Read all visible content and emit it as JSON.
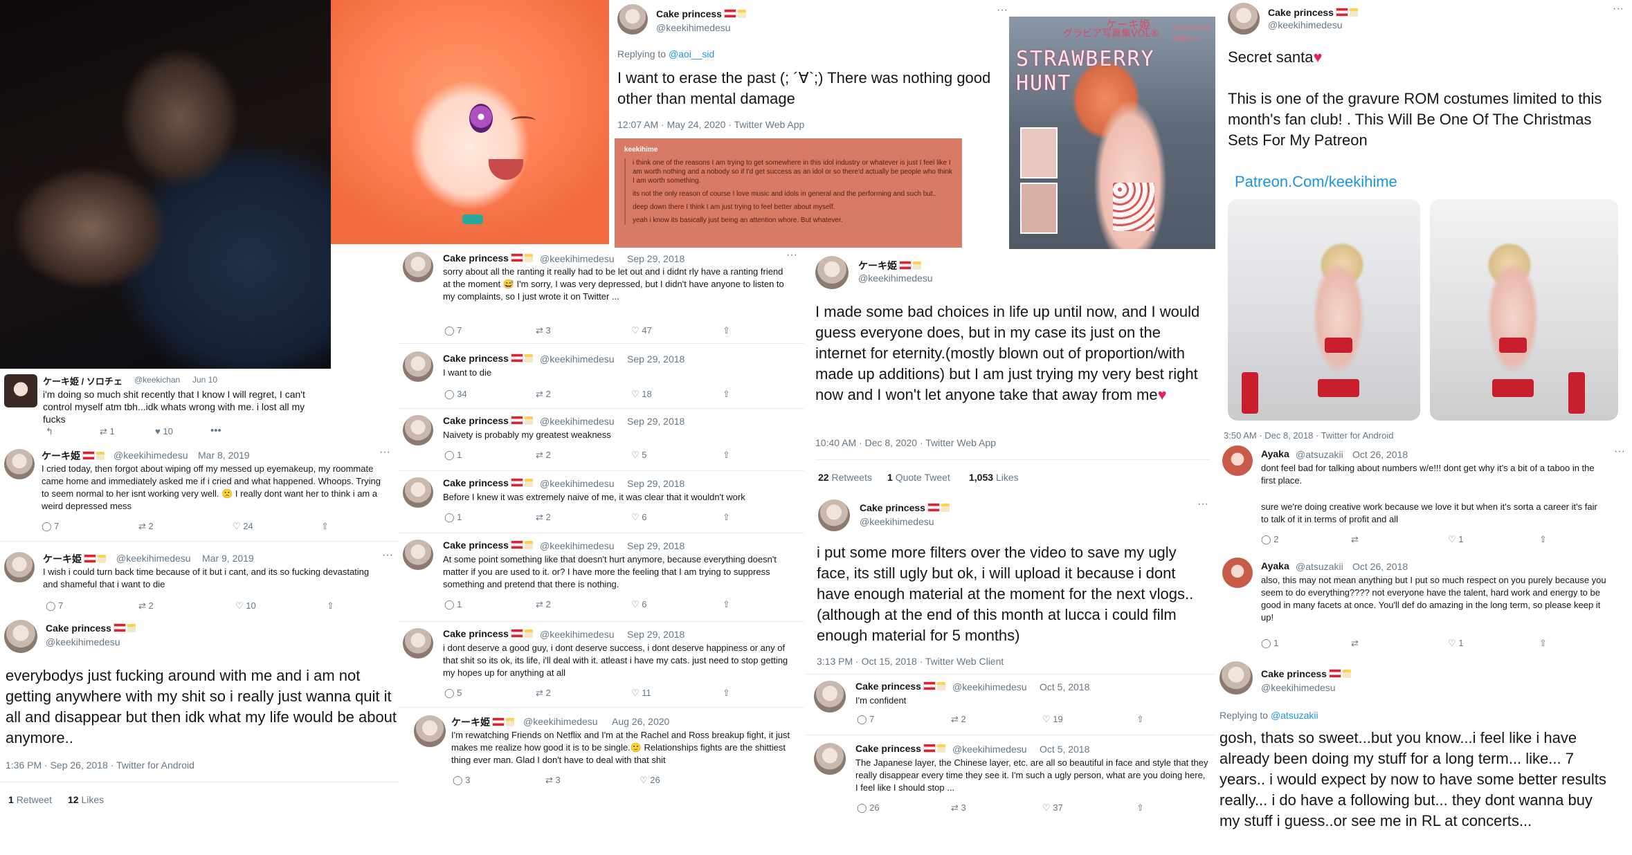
{
  "tweets": {
    "t_keechan": {
      "name": "ケーキ姫 / ソロチェ",
      "handle": "@keekichan",
      "date": "Jun 10",
      "text": "i'm doing so much shit recently that I know I will regret, I can't control myself atm tbh...idk whats wrong with me. i lost all my fucks",
      "retweets": "1",
      "likes": "10"
    },
    "t_mar8": {
      "name": "ケーキ姫",
      "handle": "@keekihimedesu",
      "date": "Mar 8, 2019",
      "text": "I cried today, then forgot about wiping off my messed up eyemakeup, my roommate came home and immediately asked me if i cried and what happened. Whoops. Trying to seem normal to her isnt working very well. 🙁 I really dont want her to think i am a weird depressed mess",
      "replies": "7",
      "retweets": "2",
      "likes": "24"
    },
    "t_mar9": {
      "name": "ケーキ姫",
      "handle": "@keekihimedesu",
      "date": "Mar 9, 2019",
      "text": "I wish i could turn back time because of it but i cant, and its so fucking devastating and shameful that i want to die",
      "replies": "7",
      "retweets": "2",
      "likes": "10"
    },
    "t_sep26": {
      "name": "Cake princess",
      "handle": "@keekihimedesu",
      "text": "everybodys just fucking around with me and i am not getting anywhere with my shit so i really just wanna quit it all and disappear but then idk what my life would be about anymore..",
      "time": "1:36 PM · Sep 26, 2018 · Twitter for Android",
      "retweets": "1",
      "retweets_label": "Retweet",
      "likes": "12",
      "likes_label": "Likes"
    },
    "t_may24": {
      "name": "Cake princess",
      "handle": "@keekihimedesu",
      "replying": "Replying to",
      "replying_to": "@aoi__sid",
      "text": "I want to erase the past (; ´∀`;) There was nothing good other than mental damage",
      "time": "12:07 AM · May 24, 2020 · Twitter Web App"
    },
    "note": {
      "title": "keekihime",
      "lines": [
        "i think one of the reasons I am trying to get somewhere in this idol industry or whatever is just I feel like I am worth nothing and a nobody so if I'd get success as an idol or so there'd actually be people who think I am worth something.",
        "its not the only reason of course I love music and idols in general and the performing and such but..",
        "deep down there I think I am just trying to feel better about myself.",
        "yeah i know its basically just being an attention whore. But whatever."
      ]
    },
    "s1": {
      "name": "Cake princess",
      "handle": "@keekihimedesu",
      "date": "Sep 29, 2018",
      "text": "sorry about all the ranting it really had to be let out and i didnt rly have a ranting friend at the moment 😅 I'm sorry, I was very depressed, but I didn't have anyone to listen to my complaints, so I just wrote it on Twitter ...",
      "replies": "7",
      "retweets": "3",
      "likes": "47"
    },
    "s2": {
      "name": "Cake princess",
      "handle": "@keekihimedesu",
      "date": "Sep 29, 2018",
      "text": "I want to die",
      "replies": "34",
      "retweets": "2",
      "likes": "18"
    },
    "s3": {
      "name": "Cake princess",
      "handle": "@keekihimedesu",
      "date": "Sep 29, 2018",
      "text": "Naivety is probably my greatest weakness",
      "replies": "1",
      "retweets": "2",
      "likes": "5"
    },
    "s4": {
      "name": "Cake princess",
      "handle": "@keekihimedesu",
      "date": "Sep 29, 2018",
      "text": "Before I knew it was extremely naive of me, it was clear that it wouldn't work",
      "replies": "1",
      "retweets": "2",
      "likes": "6"
    },
    "s5": {
      "name": "Cake princess",
      "handle": "@keekihimedesu",
      "date": "Sep 29, 2018",
      "text": "At some point something like that doesn't hurt anymore, because everything doesn't matter if you are used to it. or? I have more the feeling that I am trying to suppress something and pretend that there is nothing.",
      "replies": "1",
      "retweets": "2",
      "likes": "6"
    },
    "s6": {
      "name": "Cake princess",
      "handle": "@keekihimedesu",
      "date": "Sep 29, 2018",
      "text": "i dont deserve a good guy, i dont deserve success, i dont deserve happiness or any of that shit so its ok, its life, i'll deal with it. atleast i have my cats. just need to stop getting my hopes up for anything at all",
      "replies": "5",
      "retweets": "2",
      "likes": "11"
    },
    "s7": {
      "name": "ケーキ姫",
      "handle": "@keekihimedesu",
      "date": "Aug 26, 2020",
      "text": "I'm rewatching Friends on Netflix and I'm at the Rachel and Ross breakup fight, it just makes me realize how good it is to be single.🙂 Relationships fights are the shittiest thing ever man. Glad I don't have to deal with that shit",
      "replies": "3",
      "retweets": "3",
      "likes": "26"
    },
    "t_dec8_2020": {
      "name": "ケーキ姫",
      "handle": "@keekihimedesu",
      "text": "I made some bad choices in life up until now, and I would guess everyone does, but in my case its just on the internet for eternity.(mostly blown out of proportion/with made up additions) but I am just trying my very best right now and I won't let anyone take that away from me",
      "time": "10:40 AM · Dec 8, 2020 · Twitter Web App",
      "retweets": "22",
      "retweets_label": "Retweets",
      "quotes": "1",
      "quotes_label": "Quote Tweet",
      "likes": "1,053",
      "likes_label": "Likes"
    },
    "t_oct15": {
      "name": "Cake princess",
      "handle": "@keekihimedesu",
      "text": "i put some more filters over the video to save my ugly face, its still ugly but ok, i will upload it because i dont have enough material at the moment for the next vlogs.. (although at the end of this month at lucca i could film enough material for 5 months)",
      "time": "3:13 PM · Oct 15, 2018 · Twitter Web Client"
    },
    "o1": {
      "name": "Cake princess",
      "handle": "@keekihimedesu",
      "date": "Oct 5, 2018",
      "text": "I'm confident",
      "replies": "7",
      "retweets": "2",
      "likes": "19"
    },
    "o2": {
      "name": "Cake princess",
      "handle": "@keekihimedesu",
      "date": "Oct 5, 2018",
      "text": "The Japanese layer, the Chinese layer, etc. are all so beautiful in face and style that they really disappear every time they see it. I'm such a ugly person, what are you doing here, I feel like I should stop ...",
      "replies": "26",
      "retweets": "3",
      "likes": "37"
    },
    "t_santa": {
      "name": "Cake princess",
      "handle": "@keekihimedesu",
      "text1": "Secret santa",
      "text2": "This is one of the gravure ROM costumes limited to this month's fan club! . This Will Be One Of The Christmas Sets For My Patreon",
      "link": "Patreon.Com/keekihime",
      "time": "3:50 AM · Dec 8, 2018 · Twitter for Android"
    },
    "a1": {
      "name": "Ayaka",
      "handle": "@atsuzakii",
      "date": "Oct 26, 2018",
      "text1": "dont feel bad for talking about numbers w/e!!! dont get why it's a bit of a taboo in the first place.",
      "text2": "sure we're doing creative work because we love it but when it's sorta a career it's fair to talk of it in terms of profit and all",
      "replies": "2",
      "likes": "1"
    },
    "a2": {
      "name": "Ayaka",
      "handle": "@atsuzakii",
      "date": "Oct 26, 2018",
      "text": "also, this may not mean anything but I put so much respect on you purely because you seem to do everything???? not everyone have the talent, hard work and energy to be good in many facets at once. You'll def do amazing in the long term, so please keep it up!",
      "replies": "1",
      "likes": "1"
    },
    "t_reply": {
      "name": "Cake princess",
      "handle": "@keekihimedesu",
      "replying": "Replying to",
      "replying_to": "@atsuzakii",
      "text": "gosh, thats so sweet...but you know...i feel like i have already been doing my stuff for a long term... like... 7 years.. i would expect by now to have some better results really... i do have a following but... they dont wanna buy my stuff i guess..or see me in RL at concerts..."
    }
  },
  "images": {
    "poster_jp_top": "ケーキ姫",
    "poster_jp": "グラビア写真集VOL⑥",
    "poster_title": "STRAWBERRY HUNT",
    "poster_small": "50 PHOTOS\n50枚入り"
  },
  "colors": {
    "link": "#1b95e0",
    "like": "#e0245e",
    "muted": "#657786",
    "note_bg": "#d77a66"
  }
}
